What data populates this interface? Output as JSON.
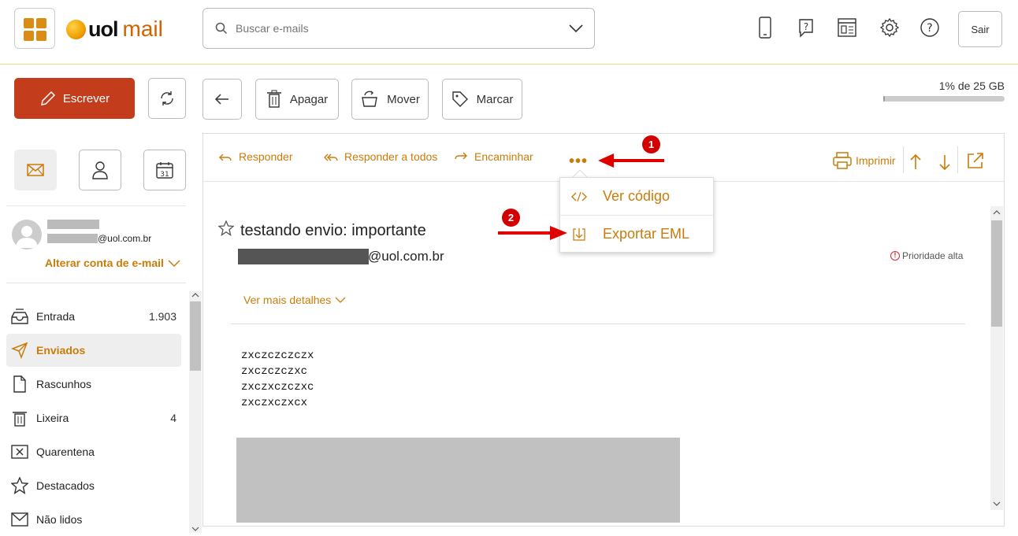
{
  "header": {
    "logo_brand": "uol",
    "logo_product": "mail",
    "search_placeholder": "Buscar e-mails",
    "logout_label": "Sair"
  },
  "toolbar": {
    "compose_label": "Escrever",
    "delete_label": "Apagar",
    "move_label": "Mover",
    "tag_label": "Marcar",
    "quota_text": "1% de 25 GB",
    "quota_percent": 1
  },
  "account": {
    "email_domain": "@uol.com.br",
    "change_account_label": "Alterar conta de e-mail"
  },
  "folders": [
    {
      "label": "Entrada",
      "count": "1.903",
      "icon": "inbox-icon"
    },
    {
      "label": "Enviados",
      "count": "",
      "icon": "send-icon",
      "active": true
    },
    {
      "label": "Rascunhos",
      "count": "",
      "icon": "draft-icon"
    },
    {
      "label": "Lixeira",
      "count": "4",
      "icon": "trash-icon"
    },
    {
      "label": "Quarentena",
      "count": "",
      "icon": "quarantine-icon"
    },
    {
      "label": "Destacados",
      "count": "",
      "icon": "star-icon"
    },
    {
      "label": "Não lidos",
      "count": "",
      "icon": "unread-icon"
    }
  ],
  "message_actions": {
    "reply": "Responder",
    "reply_all": "Responder a todos",
    "forward": "Encaminhar",
    "more": "•••",
    "print": "Imprimir"
  },
  "dropdown": {
    "view_code": "Ver código",
    "export_eml": "Exportar EML"
  },
  "message": {
    "subject": "testando envio: importante",
    "from_domain": "@uol.com.br",
    "priority": "Prioridade alta",
    "details_link": "Ver mais detalhes",
    "body_lines": [
      "zxczczczczx",
      "zxczczczxc",
      "zxczxczczxc",
      "zxczxczxcx"
    ]
  },
  "annotations": {
    "step1": "1",
    "step2": "2"
  },
  "colors": {
    "accent": "#c97c0a",
    "compose": "#c33d1c",
    "annotation": "#d40000"
  }
}
